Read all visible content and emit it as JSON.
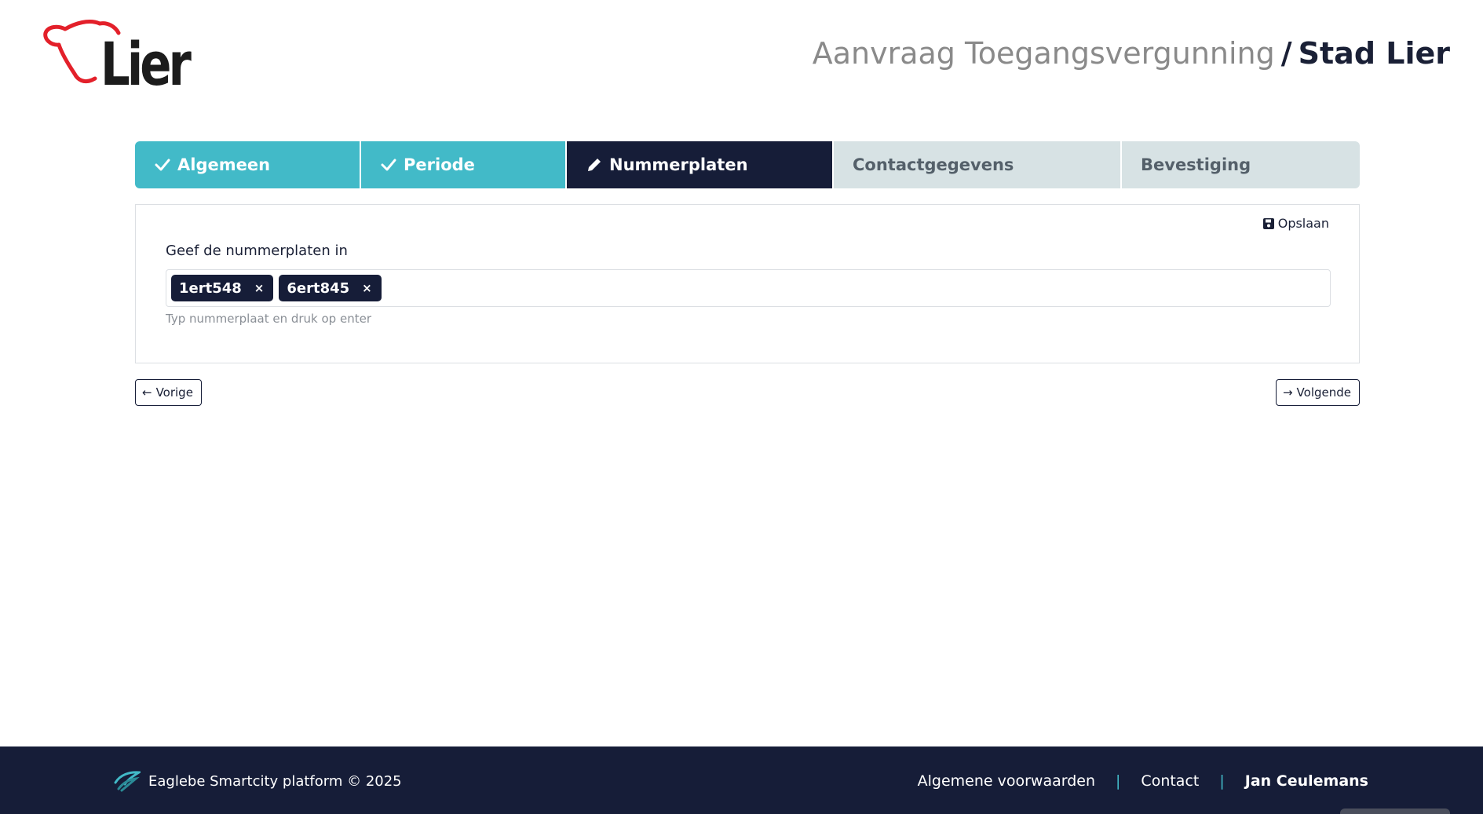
{
  "brand": {
    "logo_text": "Lier",
    "logo_color": "#e3202a"
  },
  "header": {
    "title_light": "Aanvraag Toegangsvergunning",
    "separator": "/",
    "title_bold": "Stad Lier"
  },
  "steps": [
    {
      "label": "Algemeen",
      "state": "done",
      "icon": "check-icon"
    },
    {
      "label": "Periode",
      "state": "done",
      "icon": "check-icon"
    },
    {
      "label": "Nummerplaten",
      "state": "active",
      "icon": "pencil-icon"
    },
    {
      "label": "Contactgegevens",
      "state": "todo"
    },
    {
      "label": "Bevestiging",
      "state": "todo"
    }
  ],
  "form": {
    "save_label": "Opslaan",
    "field_label": "Geef de nummerplaten in",
    "tags": [
      {
        "value": "1ert548"
      },
      {
        "value": "6ert845"
      }
    ],
    "remove_symbol": "×",
    "help_text": "Typ nummerplaat en druk op enter"
  },
  "nav": {
    "prev_label": "Vorige",
    "next_label": "Volgende"
  },
  "footer": {
    "copyright": "Eaglebe Smartcity platform © 2025",
    "terms": "Algemene voorwaarden",
    "contact": "Contact",
    "user": "Jan Ceulemans",
    "pipe": "|"
  },
  "colors": {
    "accent": "#42bac8",
    "dark": "#161d38",
    "inactive": "#d7e2e4"
  }
}
